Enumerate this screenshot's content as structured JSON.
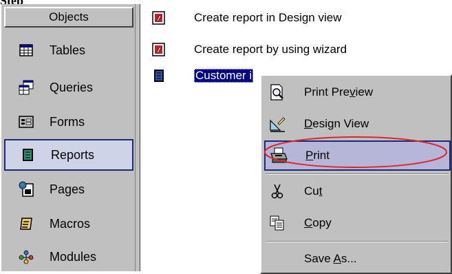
{
  "caption": "Step",
  "sidebar": {
    "header": "Objects",
    "items": [
      {
        "label": "Tables",
        "icon": "table-icon",
        "selected": false
      },
      {
        "label": "Queries",
        "icon": "query-icon",
        "selected": false
      },
      {
        "label": "Forms",
        "icon": "form-icon",
        "selected": false
      },
      {
        "label": "Reports",
        "icon": "report-icon",
        "selected": true
      },
      {
        "label": "Pages",
        "icon": "page-icon",
        "selected": false
      },
      {
        "label": "Macros",
        "icon": "macro-icon",
        "selected": false
      },
      {
        "label": "Modules",
        "icon": "module-icon",
        "selected": false
      }
    ]
  },
  "content": {
    "items": [
      {
        "label": "Create report in Design view",
        "icon": "design-wizard-icon"
      },
      {
        "label": "Create report by using wizard",
        "icon": "report-wizard-icon"
      },
      {
        "label": "Customer i",
        "icon": "report-icon",
        "selected": true
      }
    ]
  },
  "context_menu": {
    "items": [
      {
        "pre": "Print Pre",
        "key": "v",
        "post": "iew",
        "icon": "print-preview-icon"
      },
      {
        "pre": "",
        "key": "D",
        "post": "esign View",
        "icon": "design-view-icon"
      },
      {
        "pre": "",
        "key": "P",
        "post": "rint",
        "icon": "printer-icon",
        "highlight": true
      },
      {
        "pre": "Cu",
        "key": "t",
        "post": "",
        "icon": "scissors-icon"
      },
      {
        "pre": "",
        "key": "C",
        "post": "opy",
        "icon": "copy-icon"
      },
      {
        "pre": "Save ",
        "key": "A",
        "post": "s...",
        "icon": ""
      }
    ]
  },
  "colors": {
    "selection": "#000080",
    "highlight_border": "#1c2a78",
    "annotation": "#e0242a"
  }
}
